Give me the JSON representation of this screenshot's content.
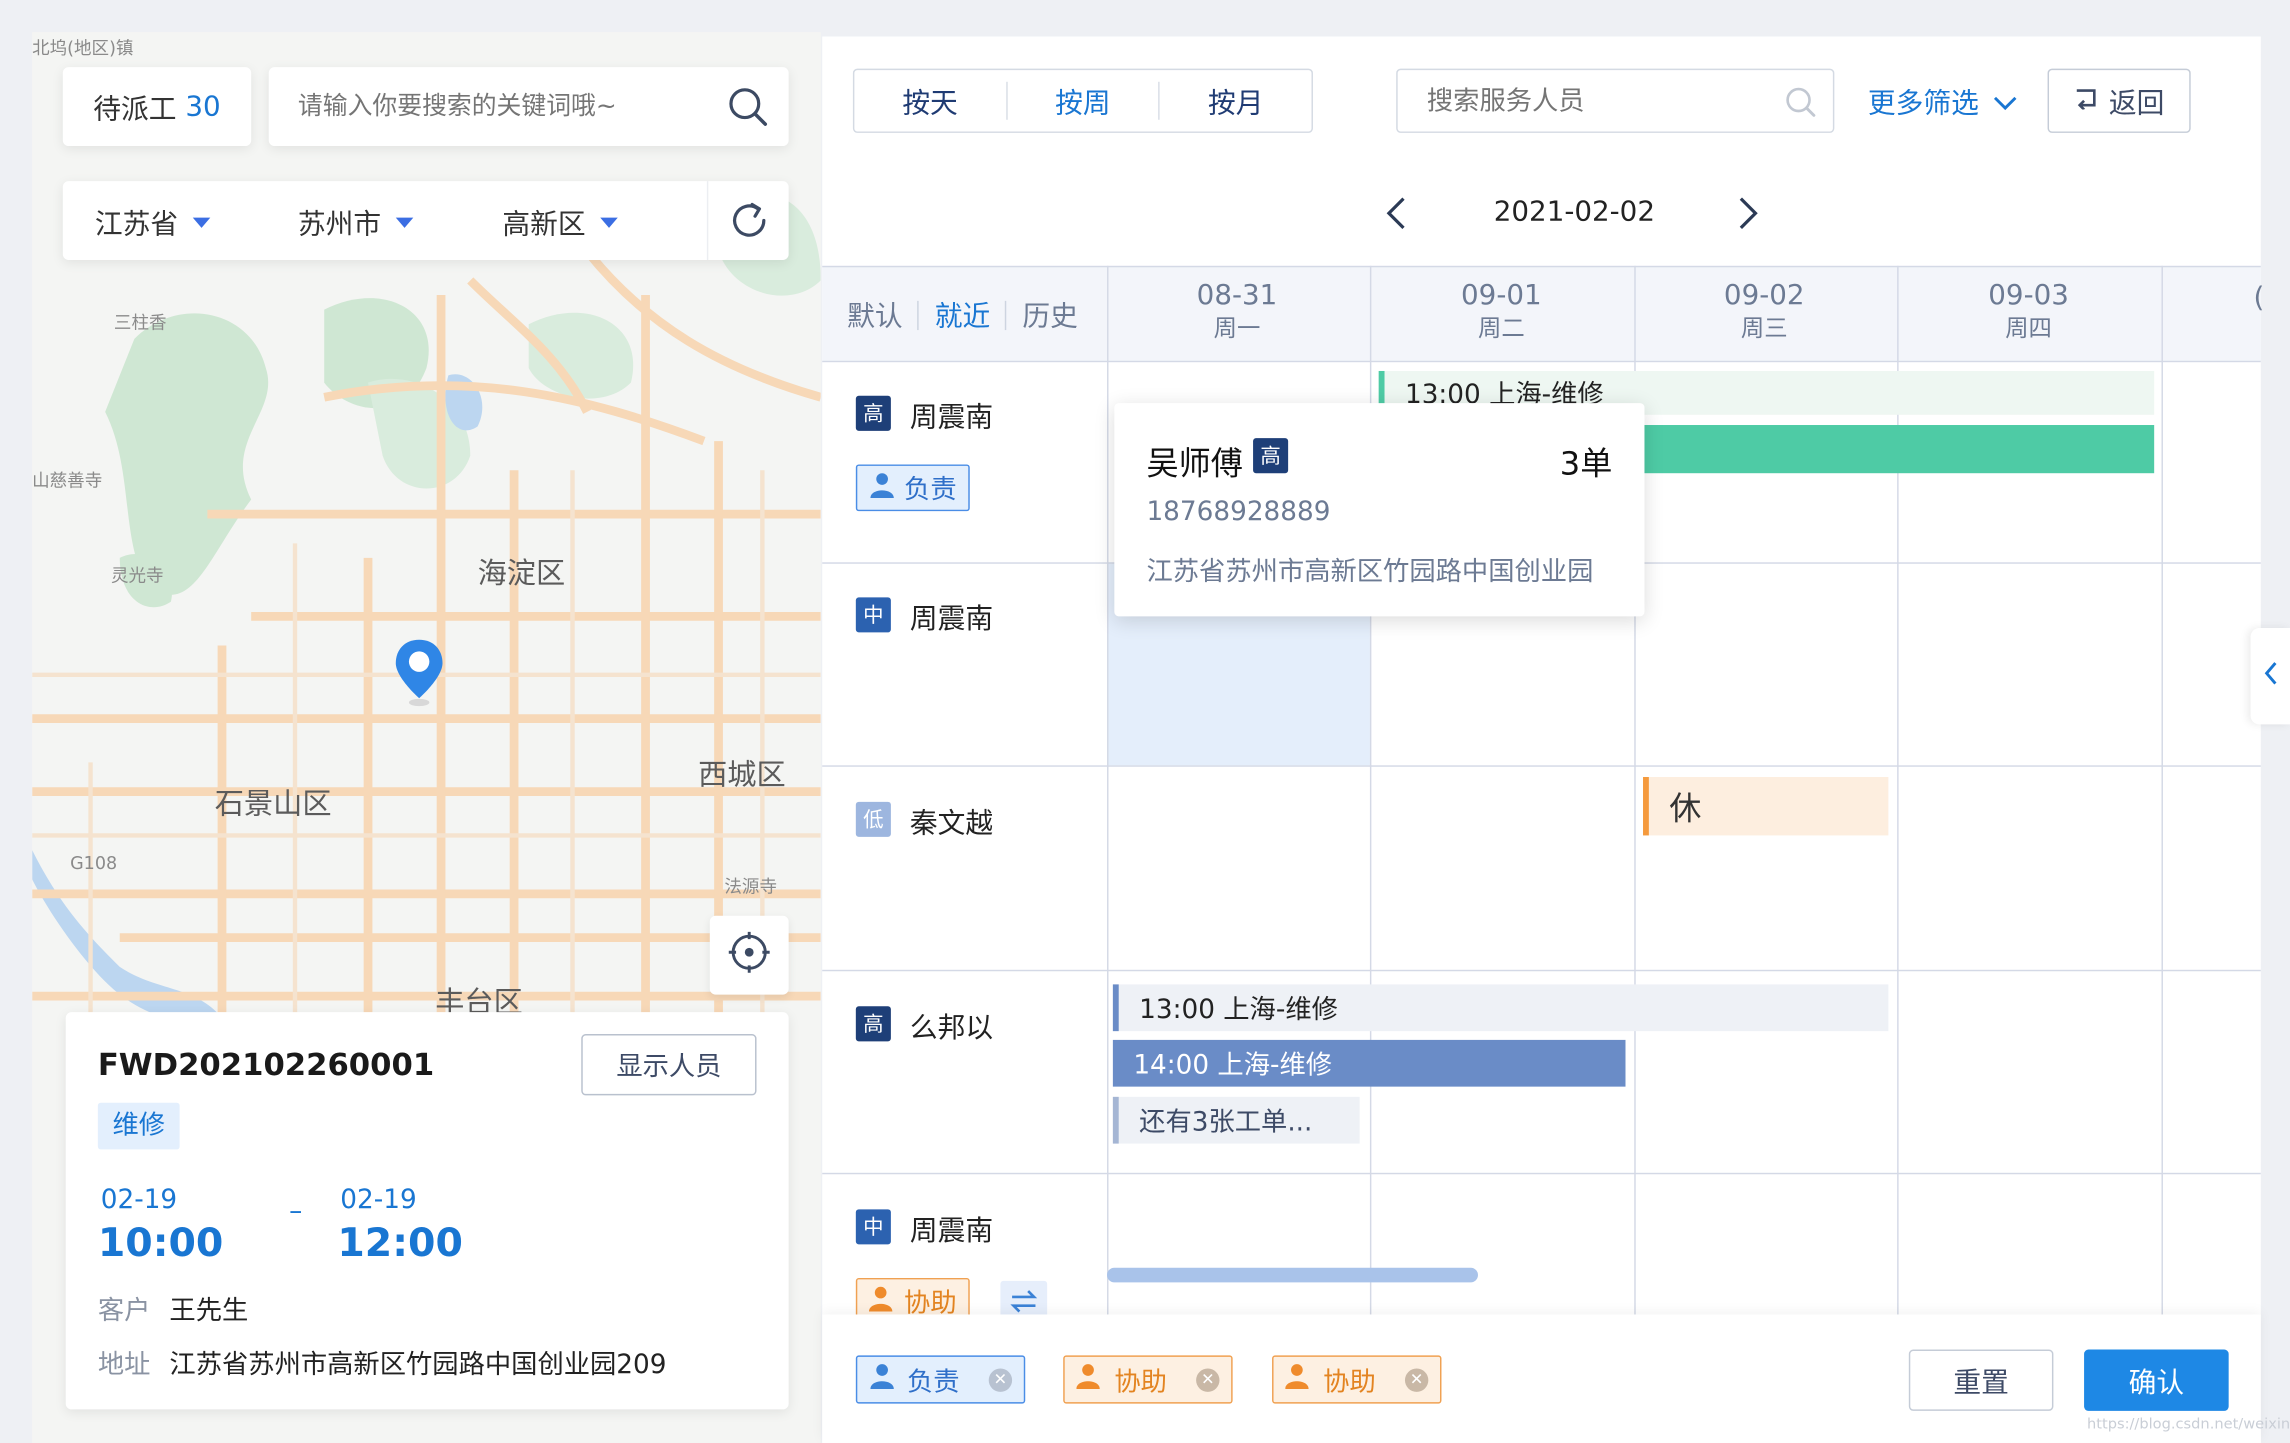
{
  "map": {
    "pending_label": "待派工",
    "pending_count": "30",
    "search_placeholder": "请输入你要搜索的关键词哦~",
    "province": "江苏省",
    "city": "苏州市",
    "district": "高新区",
    "places": [
      "海淀区",
      "西城区",
      "石景山区",
      "丰台区",
      "三柱香",
      "山慈善寺",
      "灵光寺",
      "法源寺",
      "G108",
      "北坞(地区)镇"
    ]
  },
  "order": {
    "id": "FWD202102260001",
    "show_staff_label": "显示人员",
    "type": "维修",
    "start_date": "02-19",
    "start_time": "10:00",
    "dash": "–",
    "end_date": "02-19",
    "end_time": "12:00",
    "customer_label": "客户",
    "customer": "王先生",
    "address_label": "地址",
    "address": "江苏省苏州市高新区竹园路中国创业园209"
  },
  "toolbar": {
    "views": [
      "按天",
      "按周",
      "按月"
    ],
    "active_view": 1,
    "staff_search_placeholder": "搜索服务人员",
    "more_filters": "更多筛选",
    "back": "返回",
    "date": "2021-02-02"
  },
  "sort_tabs": [
    "默认",
    "就近",
    "历史"
  ],
  "days": [
    {
      "date": "08-31",
      "weekday": "周一"
    },
    {
      "date": "09-01",
      "weekday": "周二"
    },
    {
      "date": "09-02",
      "weekday": "周三"
    },
    {
      "date": "09-03",
      "weekday": "周四"
    },
    {
      "date": "(",
      "weekday": ""
    }
  ],
  "staff": [
    {
      "level": "高",
      "name": "周震南",
      "role": "负责"
    },
    {
      "level": "中",
      "name": "周震南"
    },
    {
      "level": "低",
      "name": "秦文越"
    },
    {
      "level": "高",
      "name": "么邦以"
    },
    {
      "level": "中",
      "name": "周震南",
      "role": "协助"
    }
  ],
  "events": {
    "row1_title": "13:00 上海-维修",
    "rest_label": "休",
    "row4_a": "13:00 上海-维修",
    "row4_b": "14:00 上海-维修",
    "row4_more": "还有3张工单..."
  },
  "popup": {
    "name": "吴师傅",
    "level": "高",
    "orders": "3单",
    "phone": "18768928889",
    "address": "江苏省苏州市高新区竹园路中国创业园"
  },
  "footer": {
    "chips": [
      {
        "label": "负责",
        "kind": "blue"
      },
      {
        "label": "协助",
        "kind": "orange"
      },
      {
        "label": "协助",
        "kind": "orange"
      }
    ],
    "reset": "重置",
    "confirm": "确认",
    "watermark": "https://blog.csdn.net/weixin_..."
  },
  "colors": {
    "accent": "#1976d2",
    "primary_button": "#1e88e5",
    "event_green": "#4ecba5",
    "event_blue": "#6a8cc7",
    "rest_orange": "#f59a3d"
  }
}
